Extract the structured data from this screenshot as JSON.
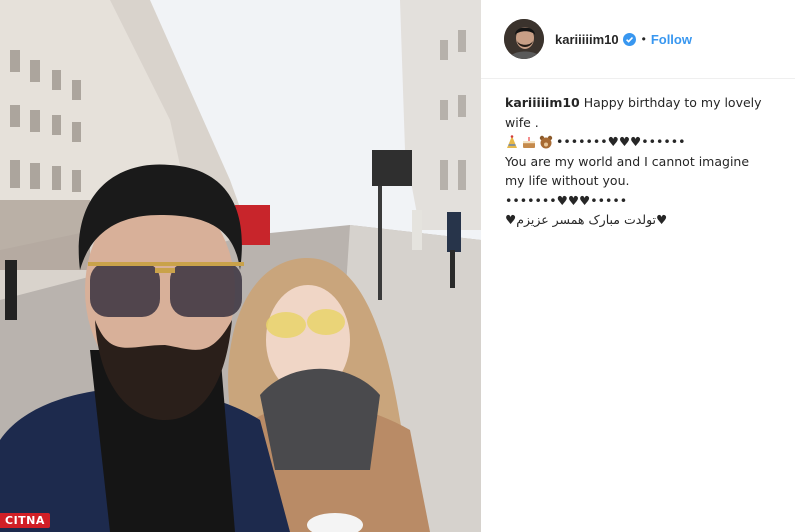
{
  "photo": {
    "alt_subject": "selfie",
    "watermark_text": "CITNA"
  },
  "header": {
    "username": "kariiiiim10",
    "separator": "•",
    "follow_label": "Follow"
  },
  "caption": {
    "username": "kariiiiim10",
    "line1": "Happy birthday to my lovely wife .",
    "line2_emoji": [
      "party-hat-icon",
      "cake-icon",
      "bear-icon"
    ],
    "line2_text": "•••••••♥♥♥••••••",
    "line3": "You are my world and I cannot imagine my life without you.",
    "line4": "•••••••♥♥♥•••••",
    "line5": "♥تولدت مبارک همسر عزیزم♥"
  },
  "colors": {
    "link": "#3897f0",
    "text": "#262626",
    "watermark_bg": "#d11f26",
    "divider": "#efefef"
  }
}
